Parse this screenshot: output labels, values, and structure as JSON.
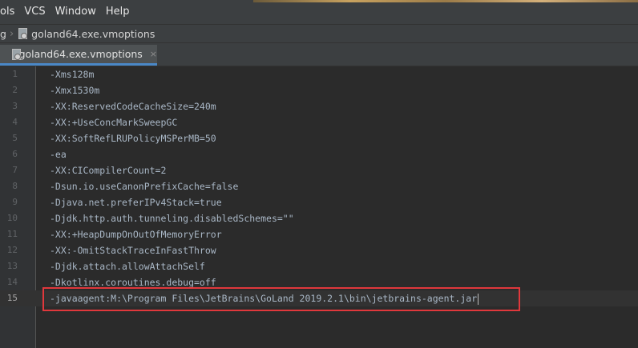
{
  "menu": {
    "items": [
      "ols",
      "VCS",
      "Window",
      "Help"
    ]
  },
  "breadcrumb": {
    "parent": "g",
    "file": "goland64.exe.vmoptions"
  },
  "tab": {
    "label": "goland64.exe.vmoptions",
    "close": "×"
  },
  "editor": {
    "current_line": 15,
    "lines": [
      {
        "num": "1",
        "text": "-Xms128m"
      },
      {
        "num": "2",
        "text": "-Xmx1530m"
      },
      {
        "num": "3",
        "text": "-XX:ReservedCodeCacheSize=240m"
      },
      {
        "num": "4",
        "text": "-XX:+UseConcMarkSweepGC"
      },
      {
        "num": "5",
        "text": "-XX:SoftRefLRUPolicyMSPerMB=50"
      },
      {
        "num": "6",
        "text": "-ea"
      },
      {
        "num": "7",
        "text": "-XX:CICompilerCount=2"
      },
      {
        "num": "8",
        "text": "-Dsun.io.useCanonPrefixCache=false"
      },
      {
        "num": "9",
        "text": "-Djava.net.preferIPv4Stack=true"
      },
      {
        "num": "10",
        "text": "-Djdk.http.auth.tunneling.disabledSchemes=\"\""
      },
      {
        "num": "11",
        "text": "-XX:+HeapDumpOnOutOfMemoryError"
      },
      {
        "num": "12",
        "text": "-XX:-OmitStackTraceInFastThrow"
      },
      {
        "num": "13",
        "text": "-Djdk.attach.allowAttachSelf"
      },
      {
        "num": "14",
        "text": "-Dkotlinx.coroutines.debug=off"
      },
      {
        "num": "15",
        "text": "-javaagent:M:\\Program Files\\JetBrains\\GoLand 2019.2.1\\bin\\jetbrains-agent.jar"
      }
    ]
  },
  "colors": {
    "highlight_box": "#e0383c",
    "tab_underline": "#4a88c7",
    "code_text": "#a9b7c6",
    "background": "#2b2b2b"
  }
}
